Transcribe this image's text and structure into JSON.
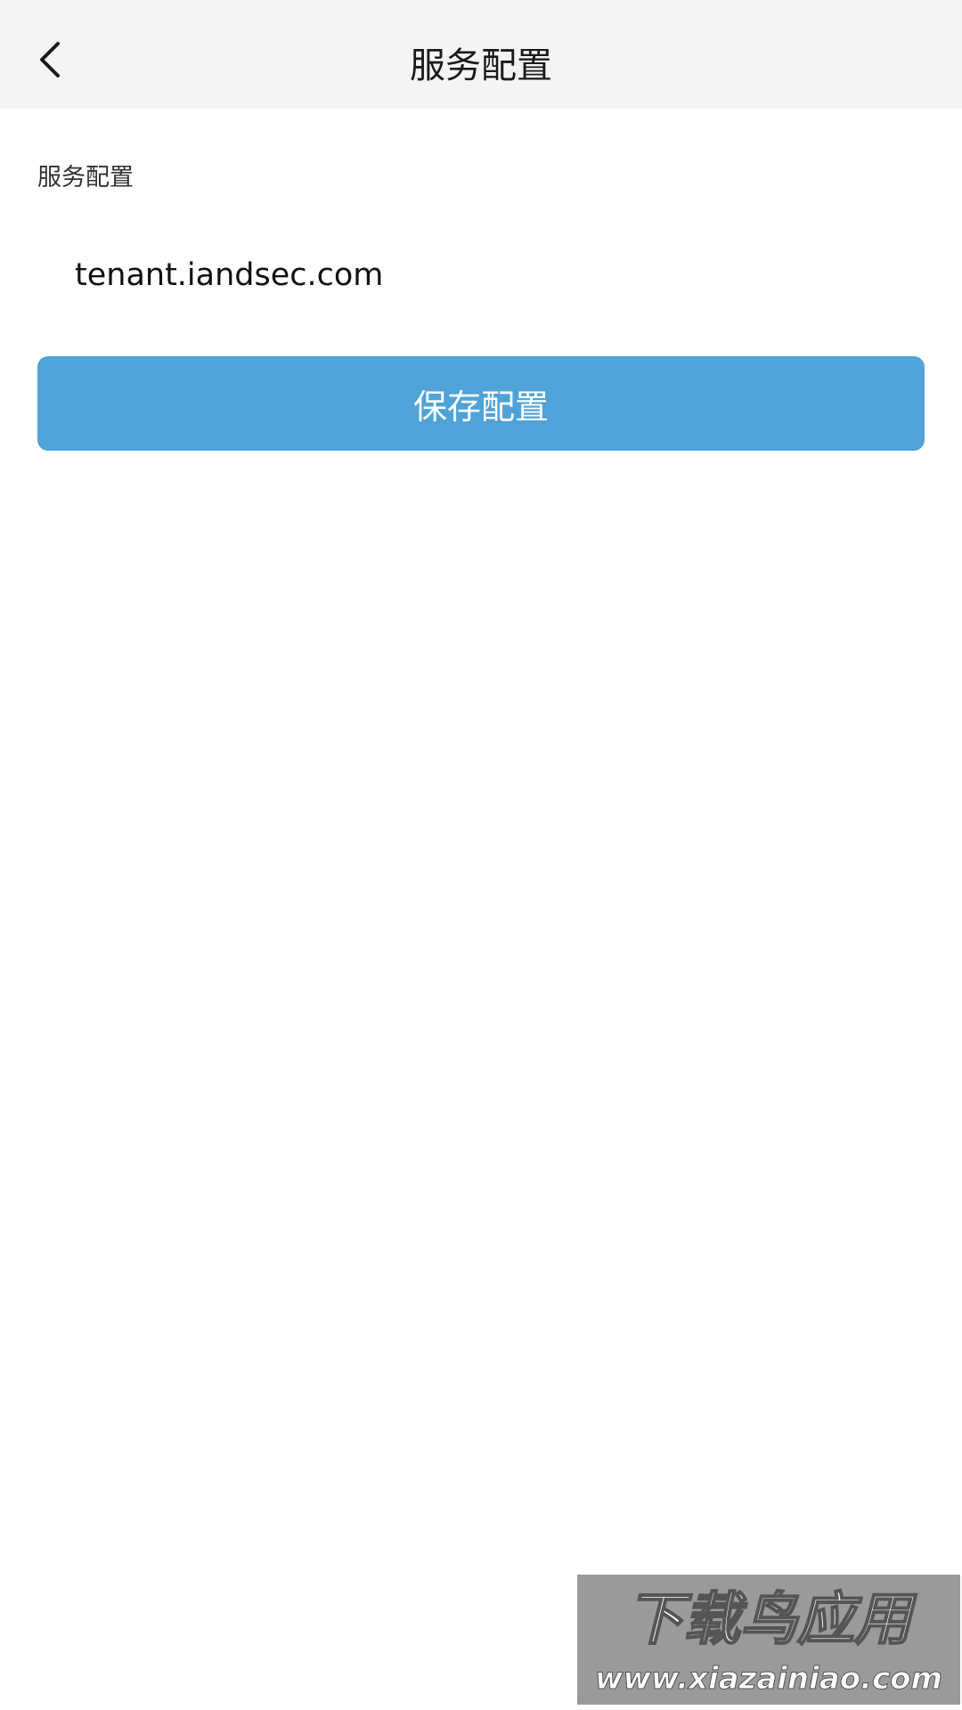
{
  "nav": {
    "title": "服务配置",
    "back_icon": "chevron-left-icon"
  },
  "form": {
    "section_label": "服务配置",
    "server_value": "tenant.iandsec.com",
    "save_label": "保存配置"
  },
  "watermark": {
    "title": "下载鸟应用",
    "url": "www.xiazainiao.com"
  },
  "colors": {
    "nav_background": "#f4f4f4",
    "accent": "#4fa3d8",
    "text_primary": "#1a1a1a"
  }
}
